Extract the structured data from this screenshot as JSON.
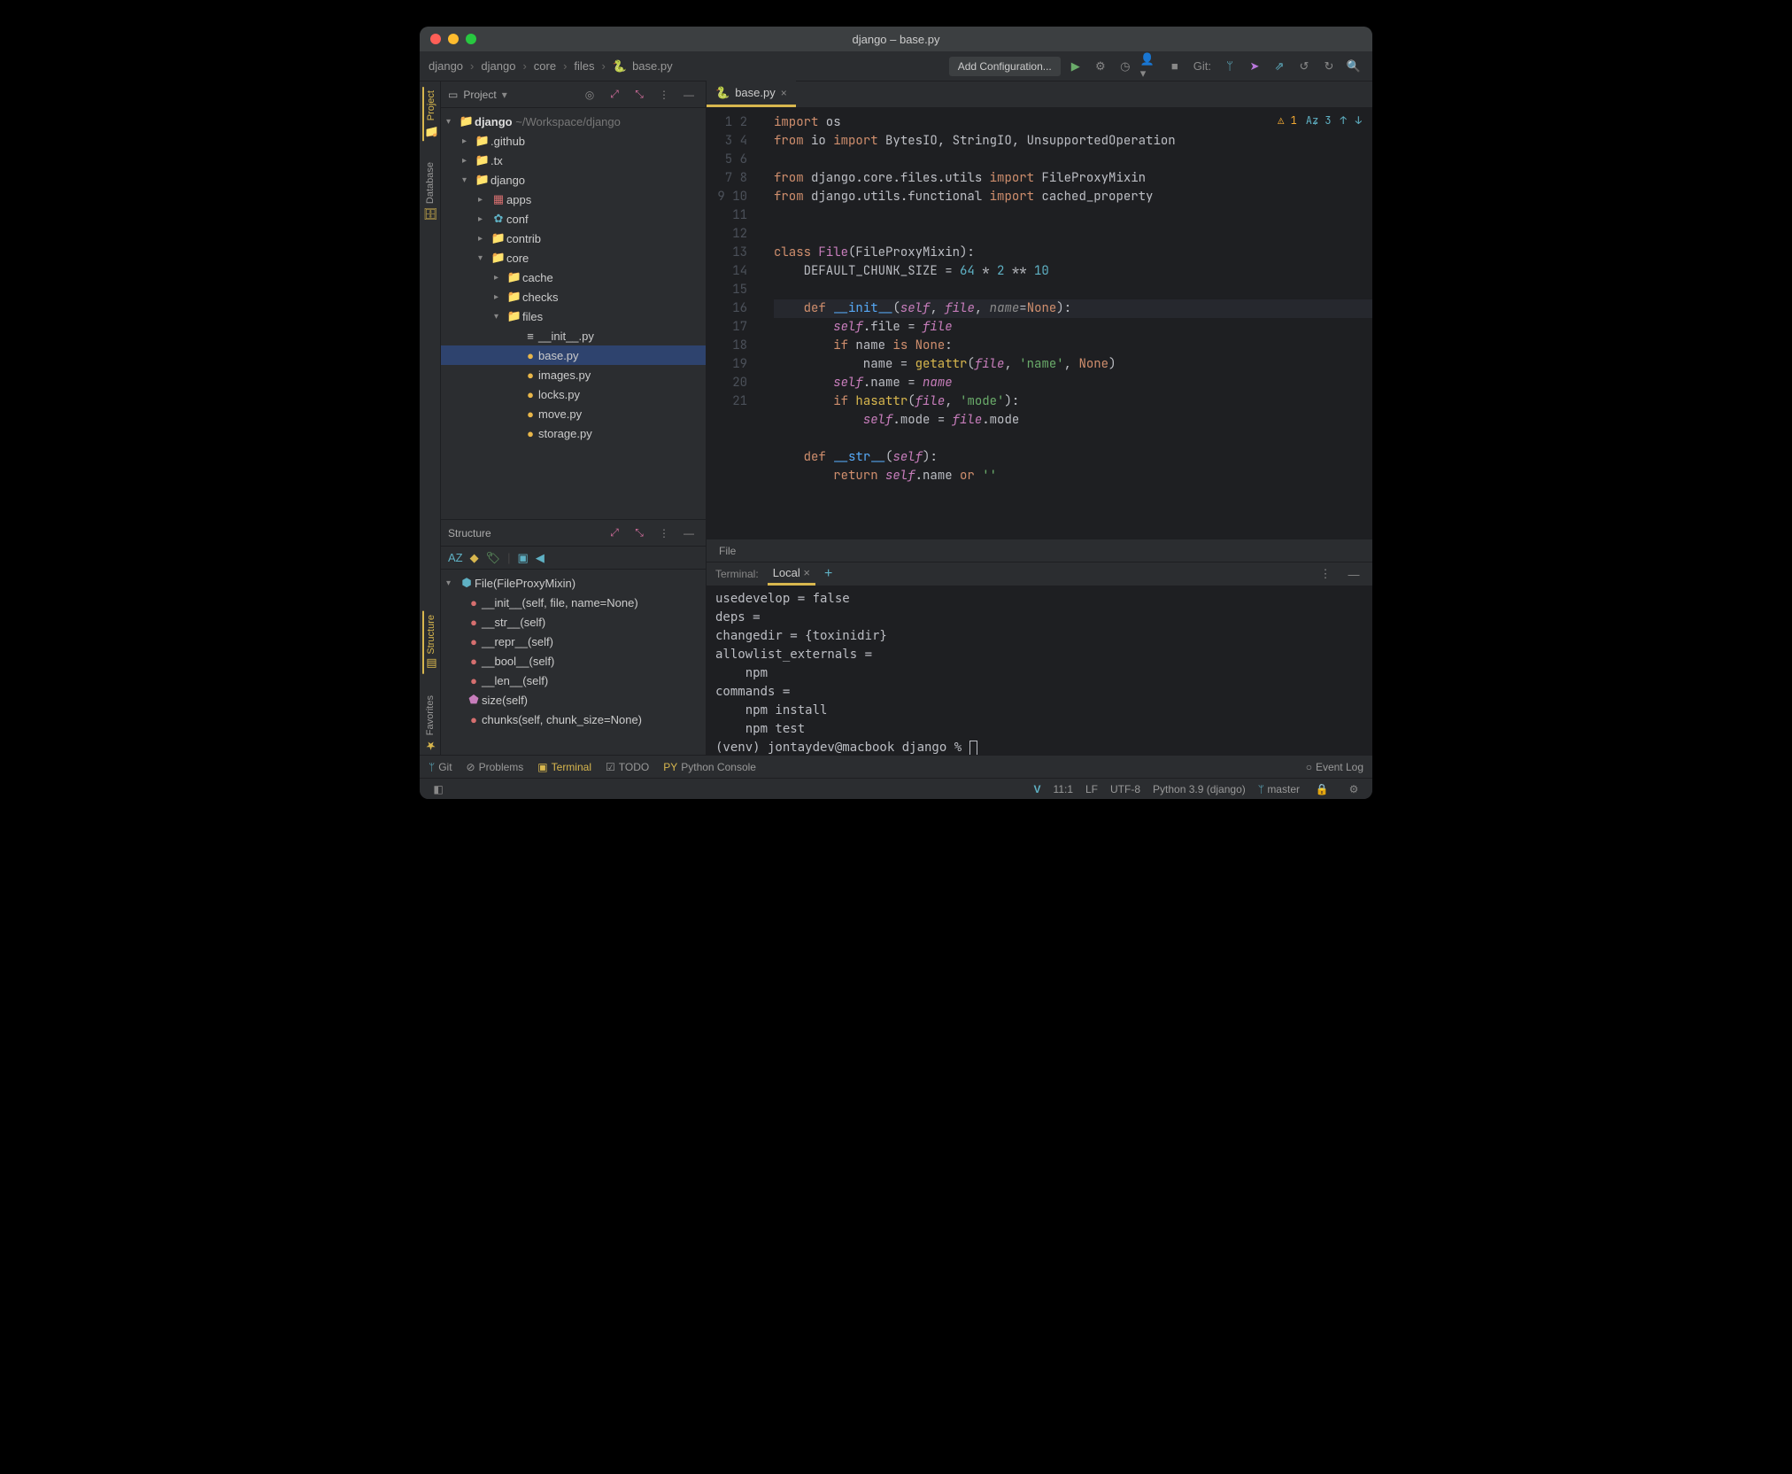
{
  "window_title": "django – base.py",
  "breadcrumb": [
    "django",
    "django",
    "core",
    "files",
    "base.py"
  ],
  "add_config_label": "Add Configuration...",
  "git_label": "Git:",
  "project_panel_title": "Project",
  "project_root": {
    "name": "django",
    "path": "~/Workspace/django"
  },
  "tree": [
    {
      "ind": 1,
      "arrow": ">",
      "ic": "📁",
      "cls": "ic-folder",
      "name": ".github",
      "prefix": ""
    },
    {
      "ind": 1,
      "arrow": ">",
      "ic": "📁",
      "cls": "ic-folder",
      "name": ".tx"
    },
    {
      "ind": 1,
      "arrow": "v",
      "ic": "📁",
      "cls": "ic-dj",
      "name": "django"
    },
    {
      "ind": 2,
      "arrow": ">",
      "ic": "▦",
      "cls": "ic-mod",
      "name": "apps"
    },
    {
      "ind": 2,
      "arrow": ">",
      "ic": "✿",
      "cls": "ic-gear",
      "name": "conf"
    },
    {
      "ind": 2,
      "arrow": ">",
      "ic": "📁",
      "cls": "ic-folder",
      "name": "contrib"
    },
    {
      "ind": 2,
      "arrow": "v",
      "ic": "📁",
      "cls": "ic-dj",
      "name": "core"
    },
    {
      "ind": 3,
      "arrow": ">",
      "ic": "📁",
      "cls": "ic-folder",
      "name": "cache"
    },
    {
      "ind": 3,
      "arrow": ">",
      "ic": "📁",
      "cls": "ic-folder",
      "name": "checks"
    },
    {
      "ind": 3,
      "arrow": "v",
      "ic": "📁",
      "cls": "ic-folder",
      "name": "files"
    },
    {
      "ind": 4,
      "arrow": "",
      "ic": "≡",
      "cls": "",
      "name": "__init__.py"
    },
    {
      "ind": 4,
      "arrow": "",
      "ic": "●",
      "cls": "ic-py",
      "name": "base.py",
      "sel": true
    },
    {
      "ind": 4,
      "arrow": "",
      "ic": "●",
      "cls": "ic-py",
      "name": "images.py"
    },
    {
      "ind": 4,
      "arrow": "",
      "ic": "●",
      "cls": "ic-py",
      "name": "locks.py"
    },
    {
      "ind": 4,
      "arrow": "",
      "ic": "●",
      "cls": "ic-py",
      "name": "move.py"
    },
    {
      "ind": 4,
      "arrow": "",
      "ic": "●",
      "cls": "ic-py",
      "name": "storage.py"
    }
  ],
  "structure_title": "Structure",
  "structure_root": "File(FileProxyMixin)",
  "structure_items": [
    "__init__(self, file, name=None)",
    "__str__(self)",
    "__repr__(self)",
    "__bool__(self)",
    "__len__(self)",
    "size(self)",
    "chunks(self, chunk_size=None)"
  ],
  "editor_tab": "base.py",
  "inspection": {
    "warnings": "1",
    "typos": "3"
  },
  "code_lines": 21,
  "breadcrumb_editor": "File",
  "terminal_label": "Terminal:",
  "terminal_tab": "Local",
  "terminal_lines": [
    "usedevelop = false",
    "deps =",
    "changedir = {toxinidir}",
    "allowlist_externals =",
    "    npm",
    "commands =",
    "    npm install",
    "    npm test"
  ],
  "terminal_prompt": "(venv) jontaydev@macbook django % ",
  "bottom_tools": {
    "git": "Git",
    "problems": "Problems",
    "terminal": "Terminal",
    "todo": "TODO",
    "pyconsole": "Python Console",
    "eventlog": "Event Log"
  },
  "status": {
    "pos": "11:1",
    "sep": "LF",
    "enc": "UTF-8",
    "interp": "Python 3.9 (django)",
    "branch": "master"
  },
  "rails": {
    "project": "Project",
    "database": "Database",
    "structure": "Structure",
    "favorites": "Favorites"
  }
}
